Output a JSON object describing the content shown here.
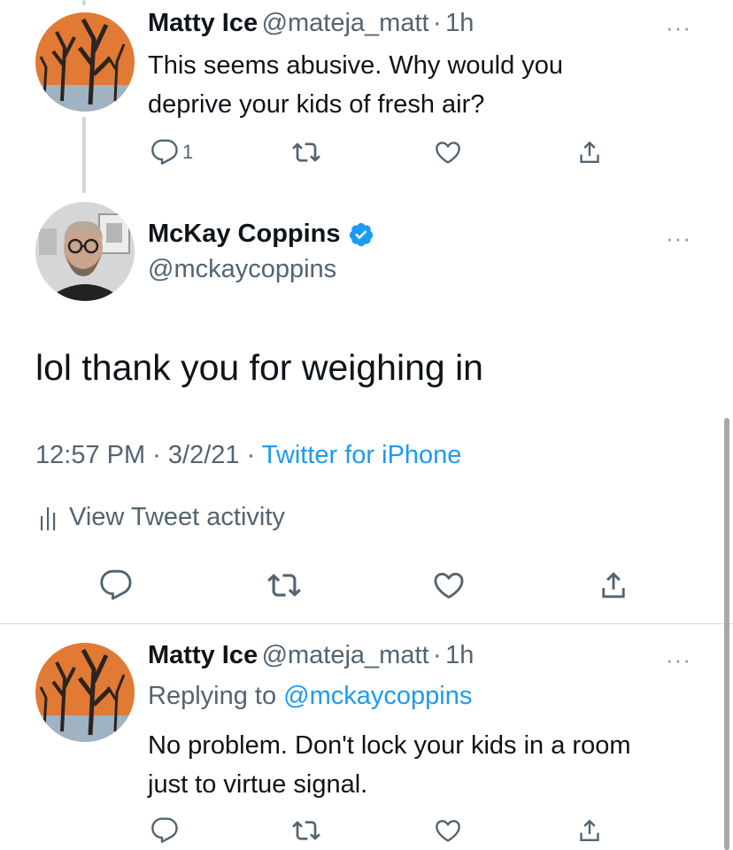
{
  "tweets": [
    {
      "name": "Matty Ice",
      "handle": "@mateja_matt",
      "separator": "·",
      "time": "1h",
      "text_lines": [
        "This seems abusive. Why would you",
        "deprive your kids of fresh air?"
      ],
      "reply_count": "1",
      "more": "···"
    },
    {
      "name": "McKay Coppins",
      "handle": "@mckaycoppins",
      "verified": true,
      "text": "lol thank you for weighing in",
      "timestamp": "12:57 PM · 3/2/21 · ",
      "source": "Twitter for iPhone",
      "activity_label": "View Tweet activity",
      "more": "···"
    },
    {
      "name": "Matty Ice",
      "handle": "@mateja_matt",
      "separator": "·",
      "time": "1h",
      "replying_prefix": "Replying to ",
      "replying_to": "@mckaycoppins",
      "text_lines": [
        "No problem. Don't lock your kids in a room",
        "just to virtue signal."
      ],
      "more": "···"
    }
  ],
  "colors": {
    "accent": "#1d9bf0",
    "text": "#0f1419",
    "muted": "#536471",
    "divider": "#cfd9de"
  },
  "icons": [
    "reply-icon",
    "retweet-icon",
    "like-icon",
    "share-icon",
    "verified-badge-icon",
    "bar-chart-icon"
  ]
}
